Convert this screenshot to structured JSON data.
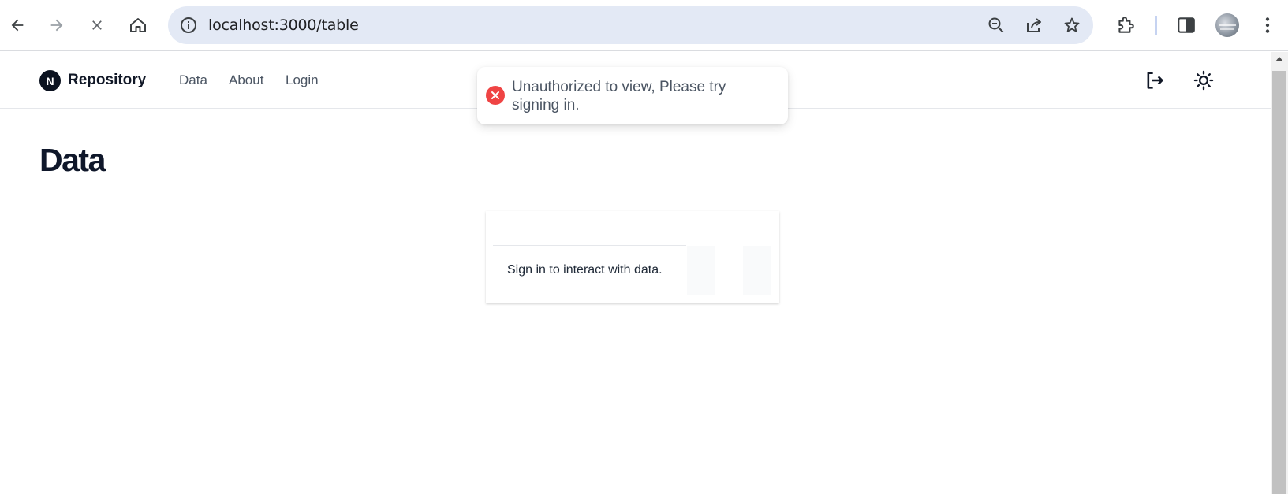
{
  "browser": {
    "url": "localhost:3000/table",
    "colors": {
      "toolbar_bg": "#ffffff",
      "omnibox_bg": "#e3e9f5"
    },
    "icons": [
      "back-arrow-icon",
      "forward-arrow-icon",
      "stop-loading-icon",
      "home-icon",
      "site-info-icon",
      "zoom-out-icon",
      "share-icon",
      "bookmark-star-icon",
      "extensions-icon",
      "side-panel-icon",
      "profile-avatar",
      "kebab-menu-icon"
    ]
  },
  "header": {
    "brand": "Repository",
    "logo_letter": "N",
    "nav": [
      {
        "label": "Data"
      },
      {
        "label": "About"
      },
      {
        "label": "Login"
      }
    ],
    "icons": [
      "login-icon",
      "theme-toggle-sun-icon"
    ]
  },
  "page": {
    "title": "Data"
  },
  "table_card": {
    "empty_message": "Sign in to interact with data."
  },
  "toast": {
    "message": "Unauthorized to view, Please try signing in.",
    "icon": "error-x-icon",
    "accent": "#ef4444"
  }
}
